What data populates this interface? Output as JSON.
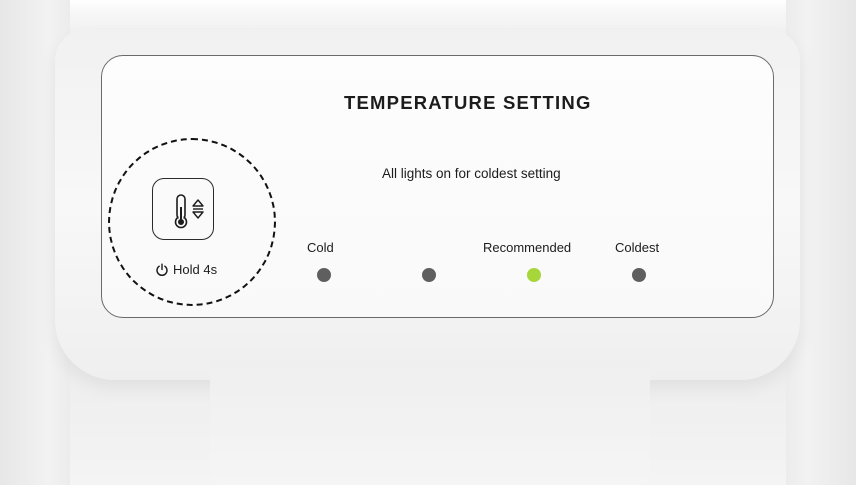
{
  "panel": {
    "title": "TEMPERATURE SETTING",
    "subtitle": "All lights on for coldest setting"
  },
  "control": {
    "button_icon": "thermometer-up-down-icon",
    "hold_icon": "power-icon",
    "hold_label": "Hold 4s"
  },
  "levels": {
    "labels": {
      "cold": "Cold",
      "recommended": "Recommended",
      "coldest": "Coldest"
    },
    "indicators": [
      {
        "state": "off",
        "color": "#5f5f5f"
      },
      {
        "state": "off",
        "color": "#5f5f5f"
      },
      {
        "state": "on",
        "color": "#a7d63b"
      },
      {
        "state": "off",
        "color": "#5f5f5f"
      }
    ]
  }
}
